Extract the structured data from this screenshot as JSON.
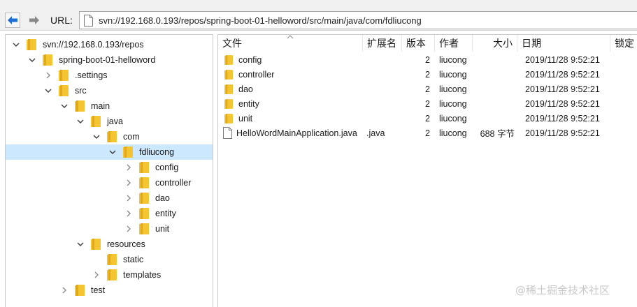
{
  "toolbar": {
    "url_label": "URL:",
    "url_value": "svn://192.168.0.193/repos/spring-boot-01-helloword/src/main/java/com/fdliucong",
    "back_icon": "arrow-left-icon",
    "forward_icon": "arrow-right-icon"
  },
  "tree": {
    "selected": "fdliucong",
    "nodes": [
      {
        "label": "svn://192.168.0.193/repos",
        "depth": 0,
        "state": "expanded"
      },
      {
        "label": "spring-boot-01-helloword",
        "depth": 1,
        "state": "expanded"
      },
      {
        "label": ".settings",
        "depth": 2,
        "state": "collapsed"
      },
      {
        "label": "src",
        "depth": 2,
        "state": "expanded"
      },
      {
        "label": "main",
        "depth": 3,
        "state": "expanded"
      },
      {
        "label": "java",
        "depth": 4,
        "state": "expanded"
      },
      {
        "label": "com",
        "depth": 5,
        "state": "expanded"
      },
      {
        "label": "fdliucong",
        "depth": 6,
        "state": "expanded"
      },
      {
        "label": "config",
        "depth": 7,
        "state": "collapsed"
      },
      {
        "label": "controller",
        "depth": 7,
        "state": "collapsed"
      },
      {
        "label": "dao",
        "depth": 7,
        "state": "collapsed"
      },
      {
        "label": "entity",
        "depth": 7,
        "state": "collapsed"
      },
      {
        "label": "unit",
        "depth": 7,
        "state": "collapsed"
      },
      {
        "label": "resources",
        "depth": 4,
        "state": "expanded"
      },
      {
        "label": "static",
        "depth": 5,
        "state": "leaf"
      },
      {
        "label": "templates",
        "depth": 5,
        "state": "collapsed"
      },
      {
        "label": "test",
        "depth": 3,
        "state": "collapsed"
      }
    ]
  },
  "list": {
    "columns": [
      "文件",
      "扩展名",
      "版本",
      "作者",
      "大小",
      "日期",
      "锁定"
    ],
    "rows": [
      {
        "name": "config",
        "type": "folder",
        "ext": "",
        "rev": "2",
        "author": "liucong",
        "size": "",
        "date": "2019/11/28 9:52:21"
      },
      {
        "name": "controller",
        "type": "folder",
        "ext": "",
        "rev": "2",
        "author": "liucong",
        "size": "",
        "date": "2019/11/28 9:52:21"
      },
      {
        "name": "dao",
        "type": "folder",
        "ext": "",
        "rev": "2",
        "author": "liucong",
        "size": "",
        "date": "2019/11/28 9:52:21"
      },
      {
        "name": "entity",
        "type": "folder",
        "ext": "",
        "rev": "2",
        "author": "liucong",
        "size": "",
        "date": "2019/11/28 9:52:21"
      },
      {
        "name": "unit",
        "type": "folder",
        "ext": "",
        "rev": "2",
        "author": "liucong",
        "size": "",
        "date": "2019/11/28 9:52:21"
      },
      {
        "name": "HelloWordMainApplication.java",
        "type": "file",
        "ext": ".java",
        "rev": "2",
        "author": "liucong",
        "size": "688 字节",
        "date": "2019/11/28 9:52:21"
      }
    ]
  },
  "watermark": "@稀土掘金技术社区",
  "colors": {
    "folder": "#f5c431",
    "selection": "#cce8ff",
    "back_arrow": "#1d6fd6"
  }
}
